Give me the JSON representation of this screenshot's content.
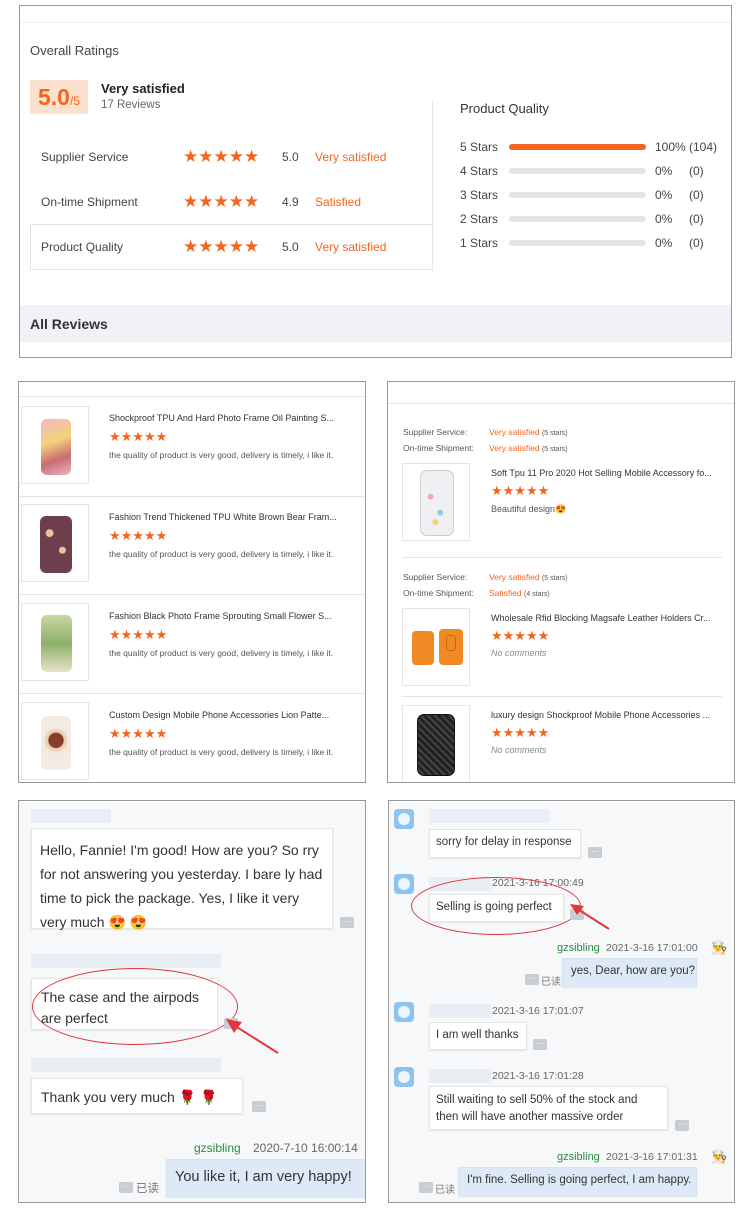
{
  "ratings": {
    "title": "Overall Ratings",
    "score": "5.0",
    "score_suffix": "/5",
    "verdict": "Very satisfied",
    "reviews_count": "17 Reviews",
    "rows": [
      {
        "label": "Supplier Service",
        "stars": 5,
        "value": "5.0",
        "verdict": "Very satisfied"
      },
      {
        "label": "On-time Shipment",
        "stars": 5,
        "value": "4.9",
        "verdict": "Satisfied"
      },
      {
        "label": "Product Quality",
        "stars": 5,
        "value": "5.0",
        "verdict": "Very satisfied"
      }
    ],
    "histogram_title": "Product Quality",
    "histogram": [
      {
        "label": "5 Stars",
        "fraction": 1.0,
        "percent": "100%",
        "count": "(104)"
      },
      {
        "label": "4 Stars",
        "fraction": 0,
        "percent": "0%",
        "count": "(0)"
      },
      {
        "label": "3 Stars",
        "fraction": 0,
        "percent": "0%",
        "count": "(0)"
      },
      {
        "label": "2 Stars",
        "fraction": 0,
        "percent": "0%",
        "count": "(0)"
      },
      {
        "label": "1 Stars",
        "fraction": 0,
        "percent": "0%",
        "count": "(0)"
      }
    ],
    "all_reviews": "All Reviews",
    "accent": "#f5641e"
  },
  "left_list": {
    "items": [
      {
        "title": "Shockproof TPU And Hard Photo Frame Oil Painting S...",
        "stars": "★★★★★",
        "text": "the quality of product is very good, delivery is timely, i like it."
      },
      {
        "title": "Fashion Trend Thickened TPU White Brown Bear Fram...",
        "stars": "★★★★★",
        "text": "the quality of product is very good, delivery is timely, i like it."
      },
      {
        "title": "Fashion Black Photo Frame Sprouting Small Flower S...",
        "stars": "★★★★★",
        "text": "the quality of product is very good, delivery is timely, i like it."
      },
      {
        "title": "Custom Design Mobile Phone Accessories Lion Patte...",
        "stars": "★★★★★",
        "text": "the quality of product is very good, delivery is timely, i like it."
      }
    ]
  },
  "right_list": {
    "supplier_label": "Supplier Service:",
    "shipment_label": "On-time Shipment:",
    "groups": [
      {
        "supplier_verdict": "Very satisfied",
        "supplier_stars": "(5 stars)",
        "shipment_verdict": "Very satisfied",
        "shipment_stars": "(5 stars)",
        "items": [
          {
            "title": "Soft Tpu 11 Pro 2020 Hot Selling Mobile Accessory fo...",
            "stars": "★★★★★",
            "text": "Beautiful design😍"
          }
        ]
      },
      {
        "supplier_verdict": "Very satisfied",
        "supplier_stars": "(5 stars)",
        "shipment_verdict": "Satisfied",
        "shipment_stars": "(4 stars)",
        "items": [
          {
            "title": "Wholesale Rfid Blocking Magsafe Leather Holders Cr...",
            "stars": "★★★★★",
            "text": "No comments"
          },
          {
            "title": "luxury design Shockproof Mobile Phone Accessories ...",
            "stars": "★★★★★",
            "text": "No comments"
          }
        ]
      }
    ]
  },
  "chat_left": {
    "messages": [
      {
        "text": "Hello, Fannie! I'm good! How are you?  So rry for not answering you yesterday. I bare ly had time to pick the package. Yes, I like it very very much  😍 😍"
      },
      {
        "text": "The case and the airpods are perfect"
      },
      {
        "text": "Thank you very much 🌹 🌹"
      }
    ],
    "reply_sender": "gzsibling",
    "reply_time": "2020-7-10 16:00:14",
    "reply_text": "You like it, I am very happy!",
    "read_label": "已读"
  },
  "chat_right": {
    "messages": [
      {
        "time": "",
        "text": "sorry for delay in response"
      },
      {
        "time": "2021-3-16 17:00:49",
        "text": "Selling is going perfect"
      },
      {
        "time": "2021-3-16 17:01:07",
        "text": "I am well thanks"
      },
      {
        "time": "2021-3-16 17:01:28",
        "text": "Still waiting to sell 50% of the stock and then will have another massive order"
      }
    ],
    "reply1_sender": "gzsibling",
    "reply1_time": "2021-3-16 17:01:00",
    "reply1_text": "yes, Dear, how are you?",
    "reply2_sender": "gzsibling",
    "reply2_time": "2021-3-16 17:01:31",
    "reply2_text": "I'm fine. Selling is going perfect, I am happy.",
    "read_label": "已读"
  }
}
